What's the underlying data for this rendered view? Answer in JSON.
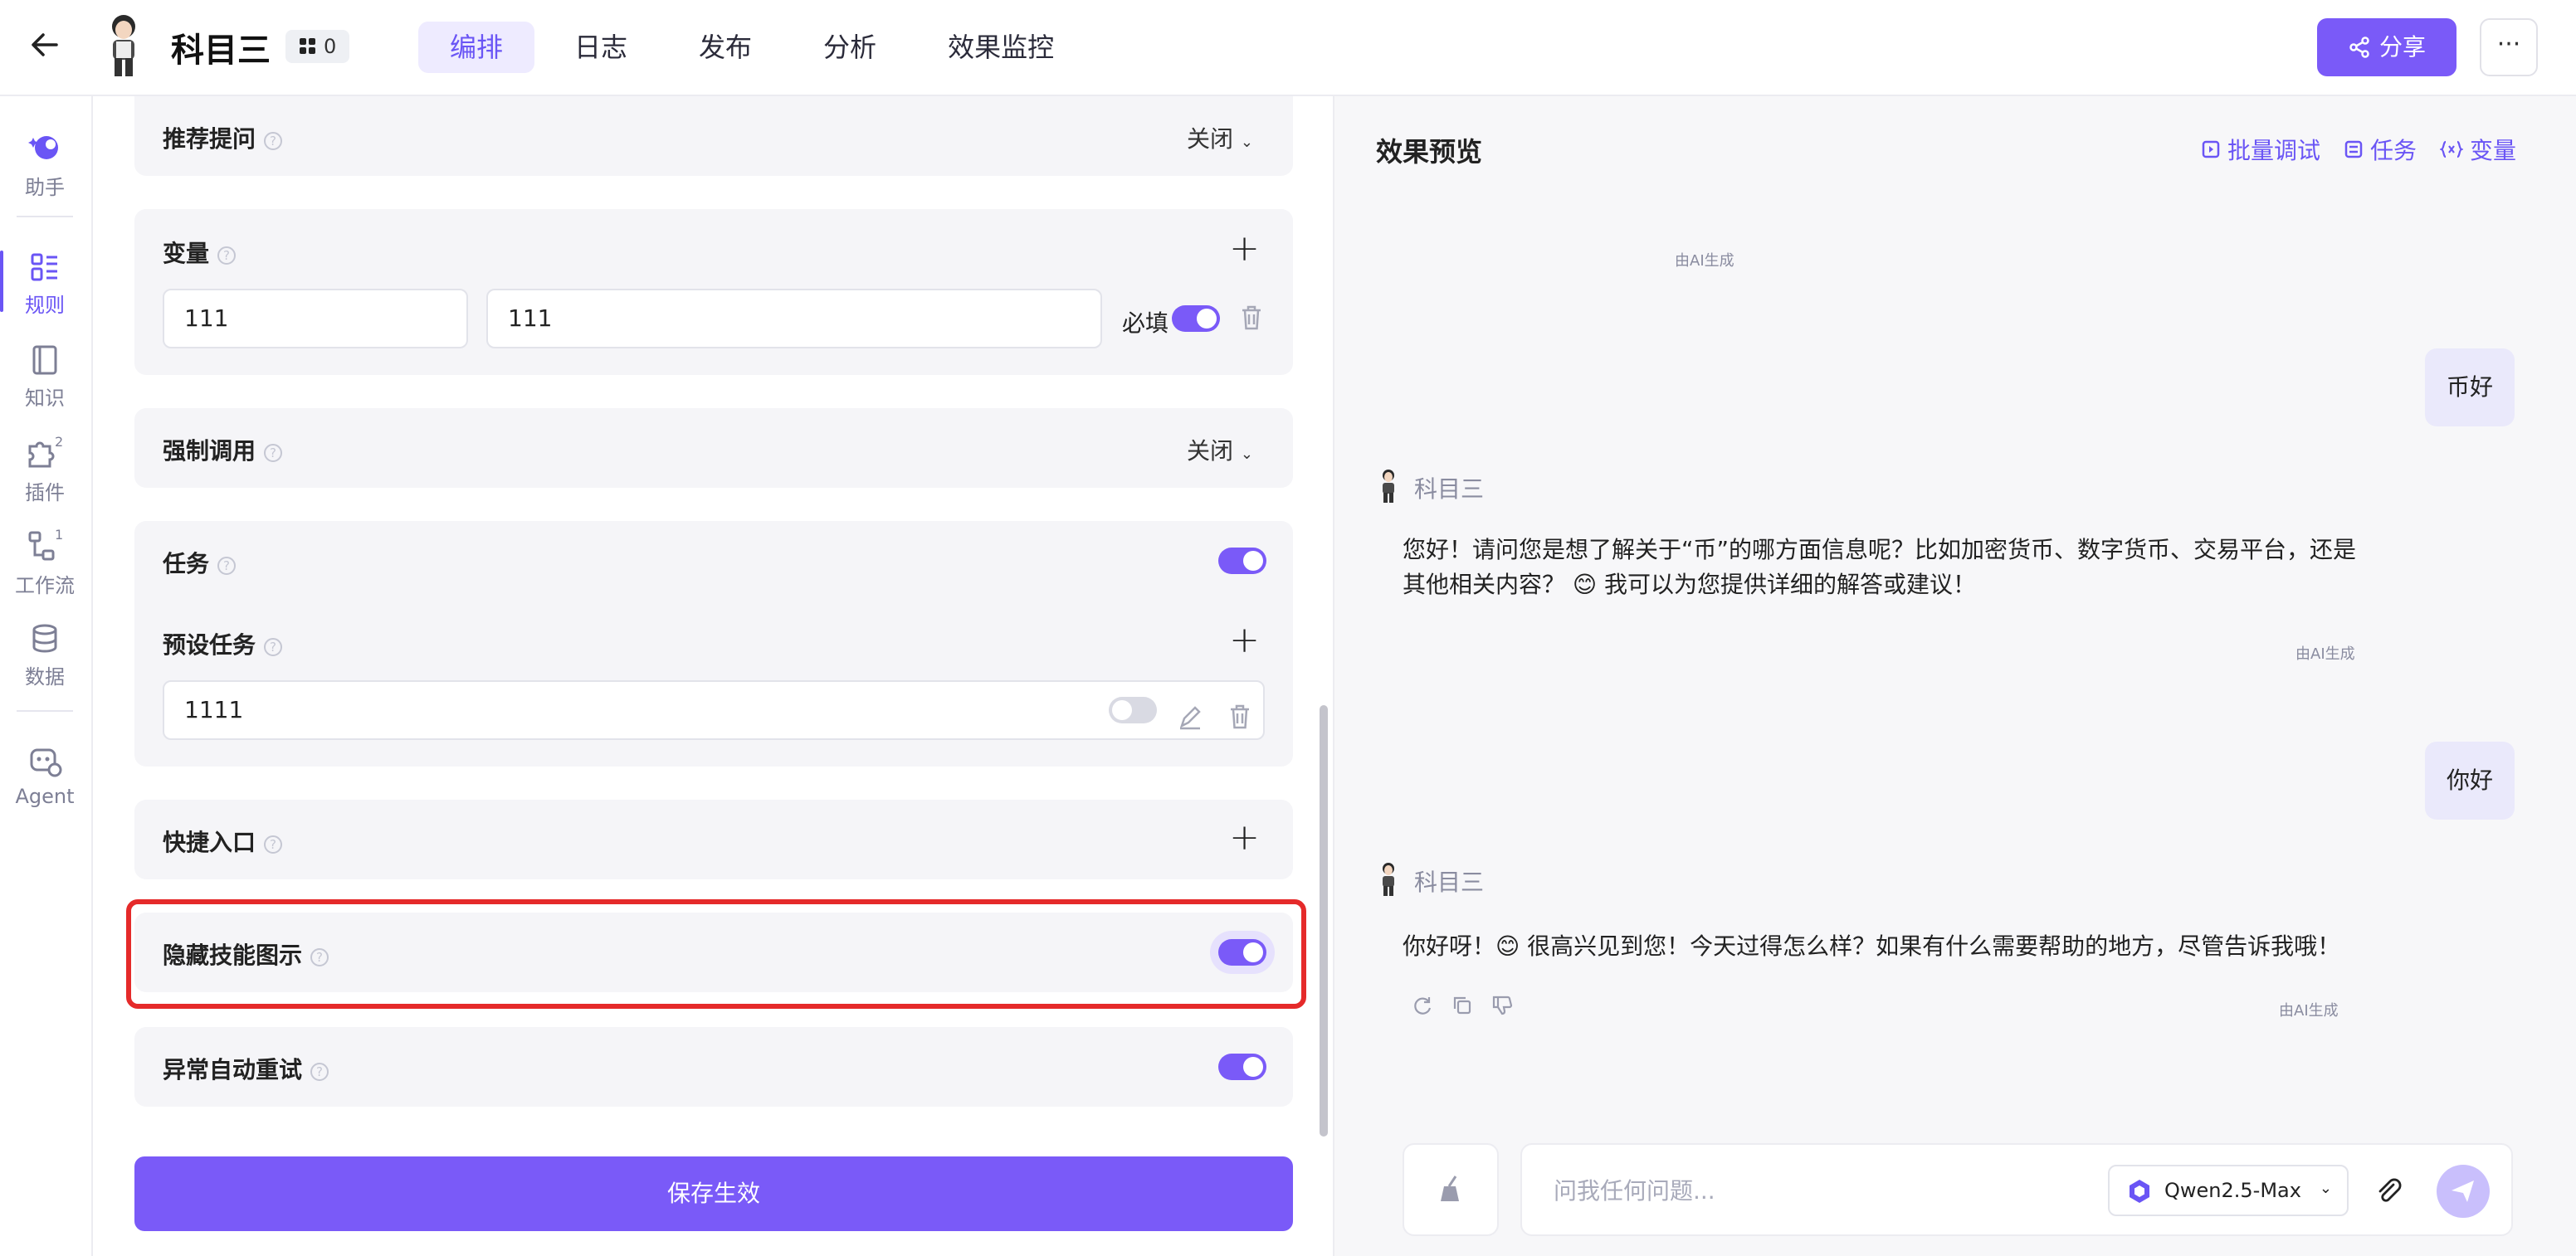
{
  "header": {
    "back_icon": "arrow-left-icon",
    "title": "科目三",
    "badge_count": "0",
    "tabs": [
      "编排",
      "日志",
      "发布",
      "分析",
      "效果监控"
    ],
    "active_tab": "编排",
    "share_label": "分享",
    "more_label": "···"
  },
  "sidebar": {
    "items": [
      {
        "label": "助手",
        "icon": "assistant-icon"
      },
      {
        "label": "规则",
        "icon": "rules-icon"
      },
      {
        "label": "知识",
        "icon": "book-icon"
      },
      {
        "label": "插件",
        "icon": "puzzle-icon",
        "badge": "2"
      },
      {
        "label": "工作流",
        "icon": "workflow-icon",
        "badge": "1"
      },
      {
        "label": "数据",
        "icon": "database-icon"
      },
      {
        "label": "Agent",
        "icon": "agent-icon"
      }
    ]
  },
  "config": {
    "recommend": {
      "title": "推荐提问",
      "value": "关闭"
    },
    "variables": {
      "title": "变量",
      "name_value": "111",
      "value_value": "111",
      "required_label": "必填",
      "required_on": true
    },
    "force_call": {
      "title": "强制调用",
      "value": "关闭"
    },
    "tasks": {
      "title": "任务",
      "enabled": true,
      "preset_title": "预设任务",
      "preset_item": "1111",
      "preset_item_enabled": false
    },
    "shortcut": {
      "title": "快捷入口"
    },
    "hide_skill": {
      "title": "隐藏技能图示",
      "enabled": true
    },
    "auto_retry": {
      "title": "异常自动重试",
      "enabled": true
    },
    "save_label": "保存生效",
    "help_glyph": "?"
  },
  "preview": {
    "title": "效果预览",
    "actions": [
      "批量调试",
      "任务",
      "变量"
    ],
    "ai_generated": "由AI生成",
    "messages": [
      {
        "role": "user",
        "text": "币好"
      },
      {
        "role": "bot",
        "name": "科目三",
        "text": "您好！请问您是想了解关于“币”的哪方面信息呢？比如加密货币、数字货币、交易平台，还是其他相关内容？ 😊 我可以为您提供详细的解答或建议！"
      },
      {
        "role": "user",
        "text": "你好"
      },
      {
        "role": "bot",
        "name": "科目三",
        "text": "你好呀！😊 很高兴见到您！今天过得怎么样？如果有什么需要帮助的地方，尽管告诉我哦！"
      }
    ],
    "input_placeholder": "问我任何问题...",
    "model": "Qwen2.5-Max"
  },
  "colors": {
    "accent": "#7a5af8",
    "highlight": "#e52a2a"
  }
}
